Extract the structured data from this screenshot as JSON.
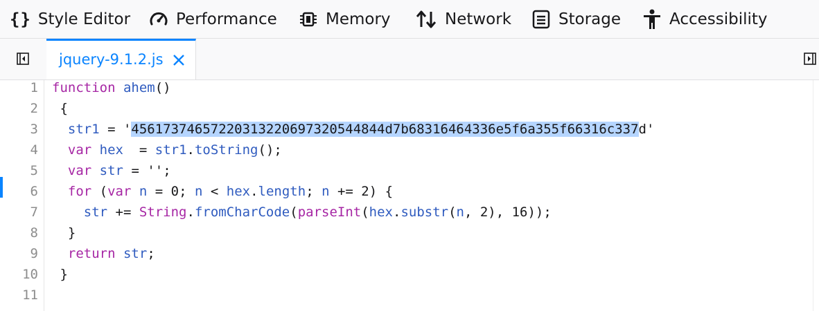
{
  "toolbar": {
    "tabs": [
      {
        "label": "Style Editor",
        "icon": "braces-icon"
      },
      {
        "label": "Performance",
        "icon": "gauge-icon"
      },
      {
        "label": "Memory",
        "icon": "memory-chip-icon"
      },
      {
        "label": "Network",
        "icon": "up-down-arrows-icon"
      },
      {
        "label": "Storage",
        "icon": "storage-icon"
      },
      {
        "label": "Accessibility",
        "icon": "accessibility-person-icon"
      }
    ],
    "braces_glyph": "{}"
  },
  "source_tab": {
    "filename": "jquery-9.1.2.js",
    "close_glyph": "×"
  },
  "editor": {
    "line_numbers": [
      "1",
      "2",
      "3",
      "4",
      "5",
      "6",
      "7",
      "8",
      "9",
      "10",
      "11"
    ],
    "lines": {
      "l1_kw": "function",
      "l1_name": "ahem",
      "l1_rest": "()",
      "l2": " {",
      "l3_id": "str1",
      "l3_mid": " = '",
      "l3_sel": "45617374657220313220697320544844d7b68316464336e5f6a355f66316c337",
      "l3_end": "d'",
      "l4_kw": "var",
      "l4_id": "hex",
      "l4_mid": "  = ",
      "l4_obj": "str1",
      "l4_dot": ".",
      "l4_fn": "toString",
      "l4_end": "();",
      "l5_kw": "var",
      "l5_id": "str",
      "l5_end": " = '';",
      "l6_kw": "for",
      "l6_a": " (",
      "l6_kw2": "var",
      "l6_n1": "n",
      "l6_b": " = 0; ",
      "l6_n2": "n",
      "l6_c": " < ",
      "l6_hex": "hex",
      "l6_d": ".",
      "l6_len": "length",
      "l6_e": "; ",
      "l6_n3": "n",
      "l6_f": " += 2) {",
      "l7_str": "str",
      "l7_a": " += ",
      "l7_String": "String",
      "l7_b": ".",
      "l7_fcc": "fromCharCode",
      "l7_c": "(",
      "l7_parse": "parseInt",
      "l7_d": "(",
      "l7_hex": "hex",
      "l7_e": ".",
      "l7_substr": "substr",
      "l7_f": "(",
      "l7_n": "n",
      "l7_g": ", 2), 16));",
      "l8": " }",
      "l9_kw": "return",
      "l9_id": "str",
      "l9_end": ";",
      "l10": " }"
    }
  },
  "colors": {
    "accent": "#0a84ff",
    "keyword": "#a626a4",
    "identifier": "#2f5bbf",
    "selection": "#b5d5ff"
  }
}
